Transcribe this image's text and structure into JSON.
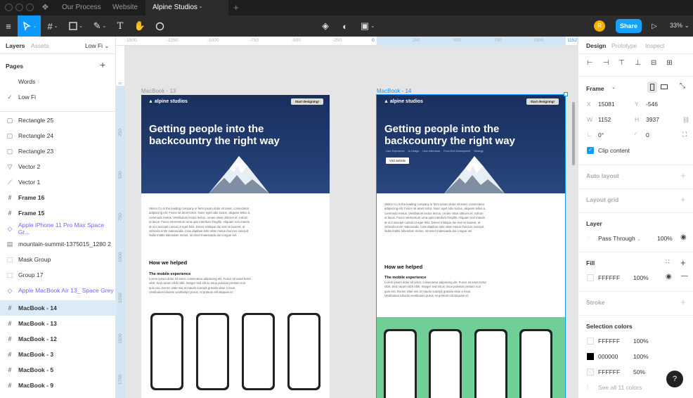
{
  "tabs": {
    "t1": "Our Process",
    "t2": "Website",
    "active": "Alpine Studios - Website"
  },
  "toolbar": {
    "avatar": "R",
    "share": "Share",
    "zoom": "33%"
  },
  "left_panel": {
    "tab_layers": "Layers",
    "tab_assets": "Assets",
    "page_select": "Low Fi",
    "pages_title": "Pages",
    "pages": [
      {
        "label": "Words"
      },
      {
        "label": "Low Fi"
      }
    ],
    "layers": [
      {
        "label": "Rectangle 25",
        "icon": "rectangle-icon"
      },
      {
        "label": "Rectangle 24",
        "icon": "rectangle-icon"
      },
      {
        "label": "Rectangle 23",
        "icon": "rectangle-icon"
      },
      {
        "label": "Vector 2",
        "icon": "vector-icon"
      },
      {
        "label": "Vector 1",
        "icon": "vector-icon"
      },
      {
        "label": "Frame 16",
        "icon": "frame-icon"
      },
      {
        "label": "Frame 15",
        "icon": "frame-icon"
      },
      {
        "label": "Apple iPhone 11 Pro Max Space Gr...",
        "icon": "component-icon"
      },
      {
        "label": "mountain-summit-1375015_1280 2",
        "icon": "image-icon"
      },
      {
        "label": "Mask Group",
        "icon": "group-icon"
      },
      {
        "label": "Group 17",
        "icon": "group-icon"
      },
      {
        "label": "Apple MacBook Air 13_ Space Grey",
        "icon": "component-icon"
      },
      {
        "label": "MacBook - 14",
        "icon": "frame-icon"
      },
      {
        "label": "MacBook - 13",
        "icon": "frame-icon"
      },
      {
        "label": "MacBook - 12",
        "icon": "frame-icon"
      },
      {
        "label": "MacBook - 3",
        "icon": "frame-icon"
      },
      {
        "label": "MacBook - 5",
        "icon": "frame-icon"
      },
      {
        "label": "MacBook - 9",
        "icon": "frame-icon"
      }
    ]
  },
  "ruler": {
    "top": [
      "-1500",
      "-1250",
      "-1000",
      "-750",
      "-500",
      "-250",
      "0",
      "250",
      "500",
      "750",
      "1000",
      "1152"
    ],
    "left": [
      "0",
      "250",
      "500",
      "750",
      "1000",
      "1250",
      "1500",
      "1750"
    ]
  },
  "canvas": {
    "frame_a": {
      "label": "MacBook - 13",
      "logo": "alpine studios",
      "cta": "Start designing!",
      "title": "Getting people into the backcountry the right way",
      "para": "Skimo Co is the leading company in ferm ipsum dolor sit amet, consectetur adipiscing elit. Fusce sit amet tortor. Nunc eget odio luctus, aliquam tellus a, commodo metus. Vestibulum lectus lectus, ornare vitae ultricies et, rutrum ut lacus. Fusce elementum urna quis interdum fringilla. Aliquam non mauris at orci suscipit cursus ut eget felis. Donec tristique dui sed mi laoreet, ut vehicula enim malesuada. Cras dapibus ante vitae metus rhoncus suscipit. Nulla mattis bibendum metus, sit amet malesuada dui congue vel.",
      "how": "How we helped",
      "mobile": "The mobile experience",
      "mobile_para": "Lorem ipsum dolor sit amet, consectetur adipiscing elit. Fusce sit amet tortor nibh. Sed rutrum nibh nibh. Integer sed elit ac risus pulvinar pretium non quis nisi. Donec vitae nisi at mauris suscipit gravida vitae a risus. Vestibulum lobortis vestibulum purus, et pretium elit aliquam id."
    },
    "frame_b": {
      "label": "MacBook - 14",
      "logo": "alpine studios",
      "cta": "Start designing!",
      "title": "Getting people into the backcountry the right way",
      "nav": [
        "User Experience",
        "UI Design",
        "User Interviews",
        "Front-End Development",
        "Strategy"
      ],
      "visit": "Visit website",
      "para": "Skimo Co is the leading company in ferm ipsum dolor sit amet, consectetur adipiscing elit. Fusce sit amet tortor. Nunc eget odio luctus, aliquam tellus a, commodo metus. Vestibulum lectus lectus, ornare vitae ultricies et, rutrum ut lacus. Fusce elementum urna quis interdum fringilla. Aliquam non mauris at orci suscipit cursus ut eget felis. Donec tristique dui sed mi laoreet, ut vehicula enim malesuada. Cras dapibus ante vitae metus rhoncus suscipit. Nulla mattis bibendum metus, sit amet malesuada dui congue vel.",
      "how": "How we helped",
      "mobile": "The mobile experience",
      "mobile_para": "Lorem ipsum dolor sit amet, consectetur adipiscing elit. Fusce sit amet tortor nibh. Sed rutrum nibh nibh. Integer sed elit ac risus pulvinar pretium non quis nisi. Donec vitae nisi at mauris suscipit gravida vitae a risus. Vestibulum lobortis vestibulum purus, et pretium elit aliquam id."
    }
  },
  "right_panel": {
    "tab_design": "Design",
    "tab_prototype": "Prototype",
    "tab_inspect": "Inspect",
    "frame_title": "Frame",
    "x_label": "X",
    "x_value": "15081",
    "y_label": "Y",
    "y_value": "-546",
    "w_label": "W",
    "w_value": "1152",
    "h_label": "H",
    "h_value": "3937",
    "rotation": "0°",
    "radius": "0",
    "clip_content": "Clip content",
    "auto_layout": "Auto layout",
    "layout_grid": "Layout grid",
    "layer_title": "Layer",
    "blend_mode": "Pass Through",
    "layer_opacity": "100%",
    "fill_title": "Fill",
    "fill_hex": "FFFFFF",
    "fill_opacity": "100%",
    "stroke_title": "Stroke",
    "selection_colors_title": "Selection colors",
    "selection_colors": [
      {
        "hex": "FFFFFF",
        "opacity": "100%",
        "color": "#ffffff"
      },
      {
        "hex": "000000",
        "opacity": "100%",
        "color": "#000000"
      },
      {
        "hex": "FFFFFF",
        "opacity": "50%",
        "color": "#ffffff"
      }
    ],
    "see_all": "See all 11 colors",
    "help": "?"
  },
  "colors": {
    "accent": "#0d99ff",
    "hero": "#1d3466",
    "green_band": "#6fcf97",
    "share": "#18a0fb"
  }
}
